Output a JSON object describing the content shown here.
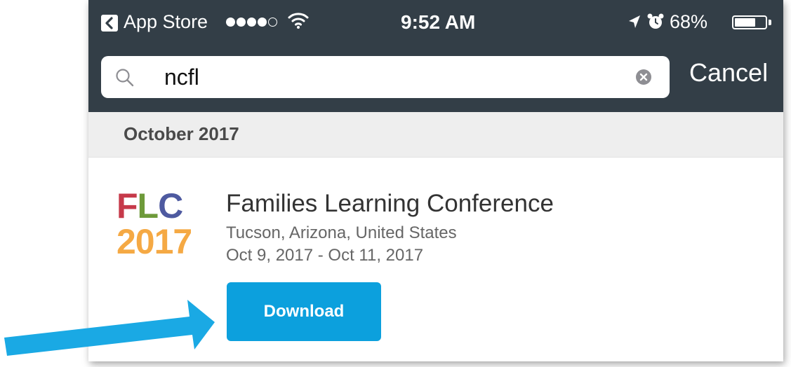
{
  "status_bar": {
    "back_app": "App Store",
    "time": "9:52 AM",
    "battery_percent": "68%",
    "battery_level": 0.68,
    "signal_bars_filled": 4,
    "signal_bars_total": 5
  },
  "search": {
    "query": "ncfl",
    "cancel_label": "Cancel"
  },
  "section": {
    "title": "October 2017"
  },
  "result": {
    "logo": {
      "line1": "FLC",
      "line2": "2017"
    },
    "title": "Families Learning Conference",
    "location": "Tucson, Arizona, United States",
    "dates": "Oct 9, 2017 - Oct 11, 2017",
    "download_label": "Download"
  },
  "colors": {
    "bar_background": "#333e47",
    "accent": "#0ca0dd",
    "arrow": "#1aa9e4",
    "logo_f": "#c63a4a",
    "logo_l": "#6e9a3a",
    "logo_c": "#4e5aa0",
    "logo_year": "#f5a944"
  }
}
